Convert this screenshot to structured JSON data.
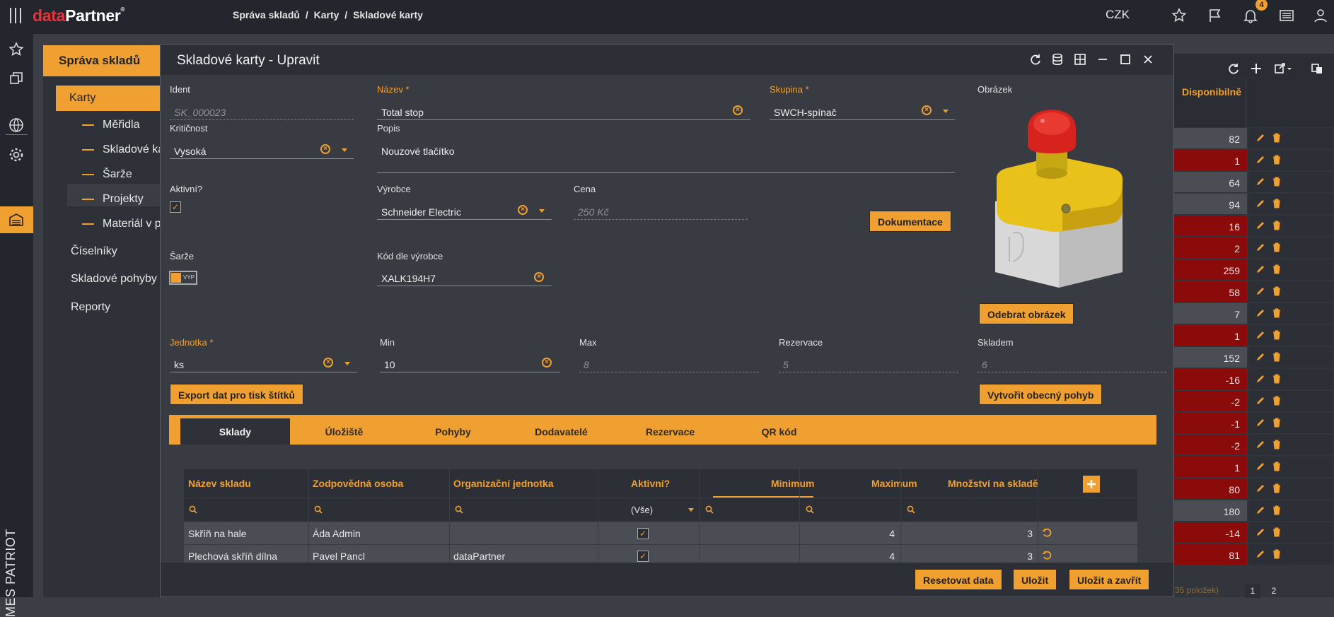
{
  "app": {
    "logo_data": "data",
    "logo_partner": "Partner",
    "logo_mark": "®",
    "breadcrumb": [
      "Správa skladů",
      "/",
      "Karty",
      "/",
      "Skladové karty"
    ],
    "currency": "CZK",
    "notification_count": "4",
    "vertical_brand": "MES PATRIOT"
  },
  "sidebar": {
    "title": "Správa skladů",
    "active": "Karty",
    "subitems": [
      "Měřidla",
      "Skladové ka",
      "Šarže",
      "Projekty",
      "Materiál v p"
    ],
    "items": [
      "Číselníky",
      "Skladové pohyby",
      "Reporty"
    ]
  },
  "background_table": {
    "column": "Disponibilně",
    "rows": [
      {
        "value": "82",
        "status": "normal"
      },
      {
        "value": "1",
        "status": "low"
      },
      {
        "value": "64",
        "status": "normal"
      },
      {
        "value": "94",
        "status": "normal"
      },
      {
        "value": "16",
        "status": "low"
      },
      {
        "value": "2",
        "status": "low"
      },
      {
        "value": "259",
        "status": "low"
      },
      {
        "value": "58",
        "status": "low"
      },
      {
        "value": "7",
        "status": "normal"
      },
      {
        "value": "1",
        "status": "low"
      },
      {
        "value": "152",
        "status": "normal"
      },
      {
        "value": "-16",
        "status": "low"
      },
      {
        "value": "-2",
        "status": "low"
      },
      {
        "value": "-1",
        "status": "low"
      },
      {
        "value": "-2",
        "status": "low"
      },
      {
        "value": "1",
        "status": "low"
      },
      {
        "value": "80",
        "status": "low"
      },
      {
        "value": "180",
        "status": "normal"
      },
      {
        "value": "-14",
        "status": "low"
      },
      {
        "value": "81",
        "status": "low"
      }
    ],
    "footer_count": "(35 položek)",
    "pages": [
      "1",
      "2"
    ]
  },
  "colors": {
    "accent": "#f0a030",
    "low_stock": "#8b0a0a",
    "normal": "#4a4d54"
  },
  "modal": {
    "title": "Skladové karty - Upravit",
    "fields": {
      "ident": {
        "label": "Ident",
        "value": "SK_000023"
      },
      "nazev": {
        "label": "Název *",
        "value": "Total stop"
      },
      "skupina": {
        "label": "Skupina *",
        "value": "SWCH-spínač"
      },
      "obrazek": {
        "label": "Obrázek"
      },
      "kriticnost": {
        "label": "Kritičnost",
        "value": "Vysoká"
      },
      "popis": {
        "label": "Popis",
        "value": "Nouzové tlačítko"
      },
      "aktivni": {
        "label": "Aktivní?",
        "checked": true
      },
      "vyrobce": {
        "label": "Výrobce",
        "value": "Schneider Electric"
      },
      "cena": {
        "label": "Cena",
        "value": "250 Kč"
      },
      "sarze": {
        "label": "Šarže",
        "toggle": "VYP"
      },
      "kod": {
        "label": "Kód dle výrobce",
        "value": "XALK194H7"
      },
      "jednotka": {
        "label": "Jednotka *",
        "value": "ks"
      },
      "min": {
        "label": "Min",
        "value": "10"
      },
      "max": {
        "label": "Max",
        "value": "8"
      },
      "rezervace": {
        "label": "Rezervace",
        "value": "5"
      },
      "skladem": {
        "label": "Skladem",
        "value": "6"
      }
    },
    "buttons": {
      "dokumentace": "Dokumentace",
      "odebrat": "Odebrat obrázek",
      "export": "Export dat pro tisk štítků",
      "vytvorit": "Vytvořit obecný pohyb",
      "reset": "Resetovat data",
      "save": "Uložit",
      "save_close": "Uložit a zavřít"
    },
    "tabs": [
      "Sklady",
      "Úložiště",
      "Pohyby",
      "Dodavatelé",
      "Rezervace",
      "QR kód"
    ],
    "grid": {
      "headers": [
        "Název skladu",
        "Zodpovědná osoba",
        "Organizační jednotka",
        "Aktivní?",
        "Minimum",
        "Maximum",
        "Množství na skladě"
      ],
      "filter_select": "(Vše)",
      "rows": [
        {
          "sklad": "Skříň na hale",
          "osoba": "Áda Admin",
          "jednotka": "",
          "aktivni": true,
          "minimum": "",
          "maximum": "4",
          "mnozstvi": "3"
        },
        {
          "sklad": "Plechová skříň dílna",
          "osoba": "Pavel Pancl",
          "jednotka": "dataPartner",
          "aktivni": true,
          "minimum": "",
          "maximum": "4",
          "mnozstvi": "3"
        }
      ]
    }
  }
}
